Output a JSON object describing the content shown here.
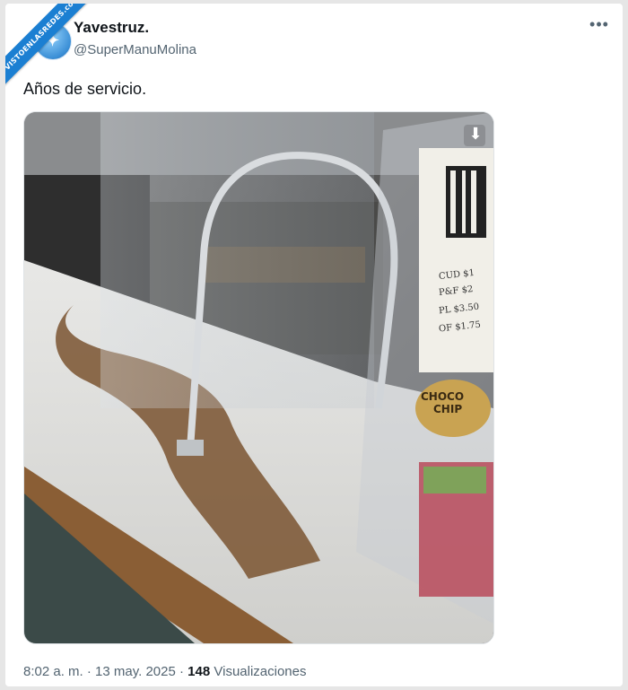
{
  "tweet": {
    "display_name": "Yavestruz.",
    "handle": "@SuperManuMolina",
    "more_icon": "more-horizontal-icon",
    "text": "Años de servicio.",
    "time": "8:02 a. m.",
    "separator": "·",
    "date": "13 may. 2025",
    "views_count": "148",
    "views_label": "Visualizaciones"
  },
  "watermark": {
    "banner_text": "VISTOENLASREDES.com"
  },
  "media": {
    "photo_text": {
      "tag_1": "CHOCO",
      "tag_2": "CHIP",
      "note_1": "CUD  $1",
      "note_2": "P&F  $2",
      "note_3": "PL  $3.50",
      "note_4": "OF  $1.75"
    },
    "download_icon": "download-arrow-icon"
  },
  "colors": {
    "text_primary": "#0f1419",
    "text_secondary": "#536471",
    "banner_blue": "#1b7fd2"
  }
}
